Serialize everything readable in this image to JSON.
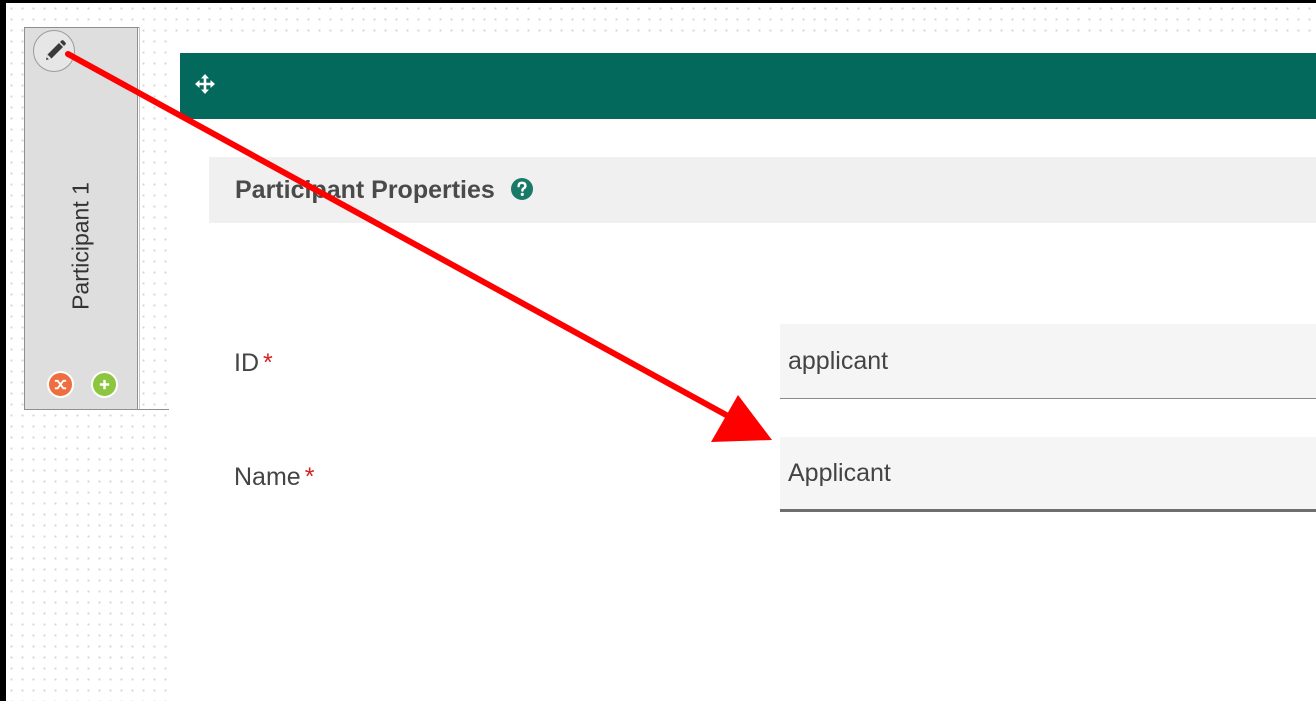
{
  "lane": {
    "label": "Participant 1",
    "icons": {
      "edit": "pencil-icon",
      "remove": "shuffle-icon",
      "add": "plus-icon"
    }
  },
  "panel": {
    "drag_icon": "move-arrows-icon",
    "section_title": "Participant Properties",
    "help_icon": "question-circle-icon",
    "fields": [
      {
        "label": "ID",
        "required_mark": "*",
        "value": "applicant"
      },
      {
        "label": "Name",
        "required_mark": "*",
        "value": "Applicant"
      }
    ]
  },
  "colors": {
    "panel_bar": "#03695c",
    "lane_header": "#dedede",
    "remove_button": "#ee6e3f",
    "add_button": "#8cc63f",
    "required_mark": "#d62020",
    "annotation_arrow": "#ff0000"
  }
}
